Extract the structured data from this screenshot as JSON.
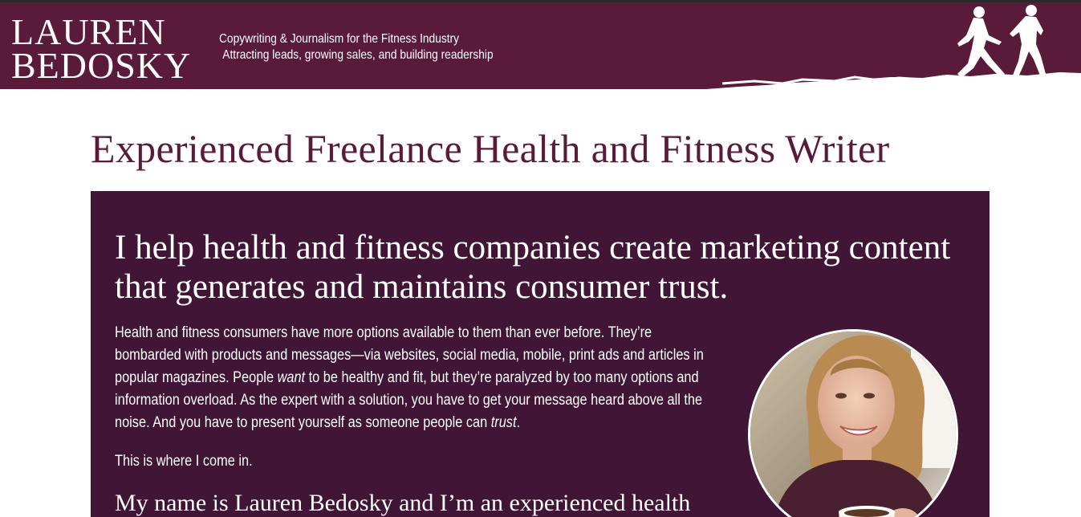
{
  "header": {
    "logo_line1": "LAUREN",
    "logo_line2": "BEDOSKY",
    "tagline_line1": "Copywriting & Journalism for the Fitness Industry",
    "tagline_line2": "Attracting leads, growing sales, and building readership",
    "background_color": "#5a1a3a"
  },
  "main": {
    "page_title": "Experienced Freelance Health and Fitness Writer",
    "panel_color": "#411535",
    "headline": "I help health and fitness companies create marketing content that generates and maintains consumer trust.",
    "body": {
      "t1": "Health and fitness consumers have more options available to them than ever before. They’re bombarded with products and messages—via websites, social media, mobile, print ads and articles in popular magazines. People ",
      "em1": "want",
      "t2": " to be healthy and fit, but they’re paralyzed by too many options and information overload. As the expert with a solution, you have to get your message heard above all the noise. And you have to present yourself as someone people can ",
      "em2": "trust",
      "t3": "."
    },
    "intro_line": "This is where I come in.",
    "subheading": "My name is Lauren Bedosky and I’m an experienced health"
  },
  "icons": {
    "runners": "runners-silhouette-icon",
    "portrait": "author-portrait-photo"
  }
}
